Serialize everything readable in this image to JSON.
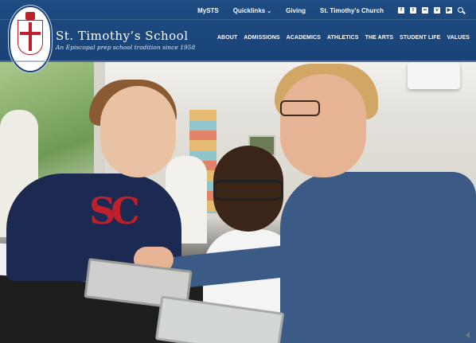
{
  "header": {
    "school_name": "St. Timothy’s School",
    "tagline": "An Episcopal prep school tradition since 1958",
    "logo_name": "st-timothys-school-seal"
  },
  "utility_nav": {
    "mysts_prefix": "My",
    "mysts_bold": "STS",
    "quicklinks": "Quicklinks",
    "giving": "Giving",
    "church": "St. Timothy’s Church"
  },
  "social_icons": [
    "facebook-icon",
    "twitter-icon",
    "flickr-icon",
    "vimeo-icon",
    "youtube-icon",
    "search-icon"
  ],
  "main_nav": [
    "ABOUT",
    "ADMISSIONS",
    "ACADEMICS",
    "ATHLETICS",
    "THE ARTS",
    "STUDENT LIFE",
    "VALUES"
  ],
  "hero": {
    "shirt_letters": "SC"
  },
  "colors": {
    "header_blue": "#1a4377",
    "accent_red": "#c0202b",
    "text_white": "#ffffff"
  }
}
